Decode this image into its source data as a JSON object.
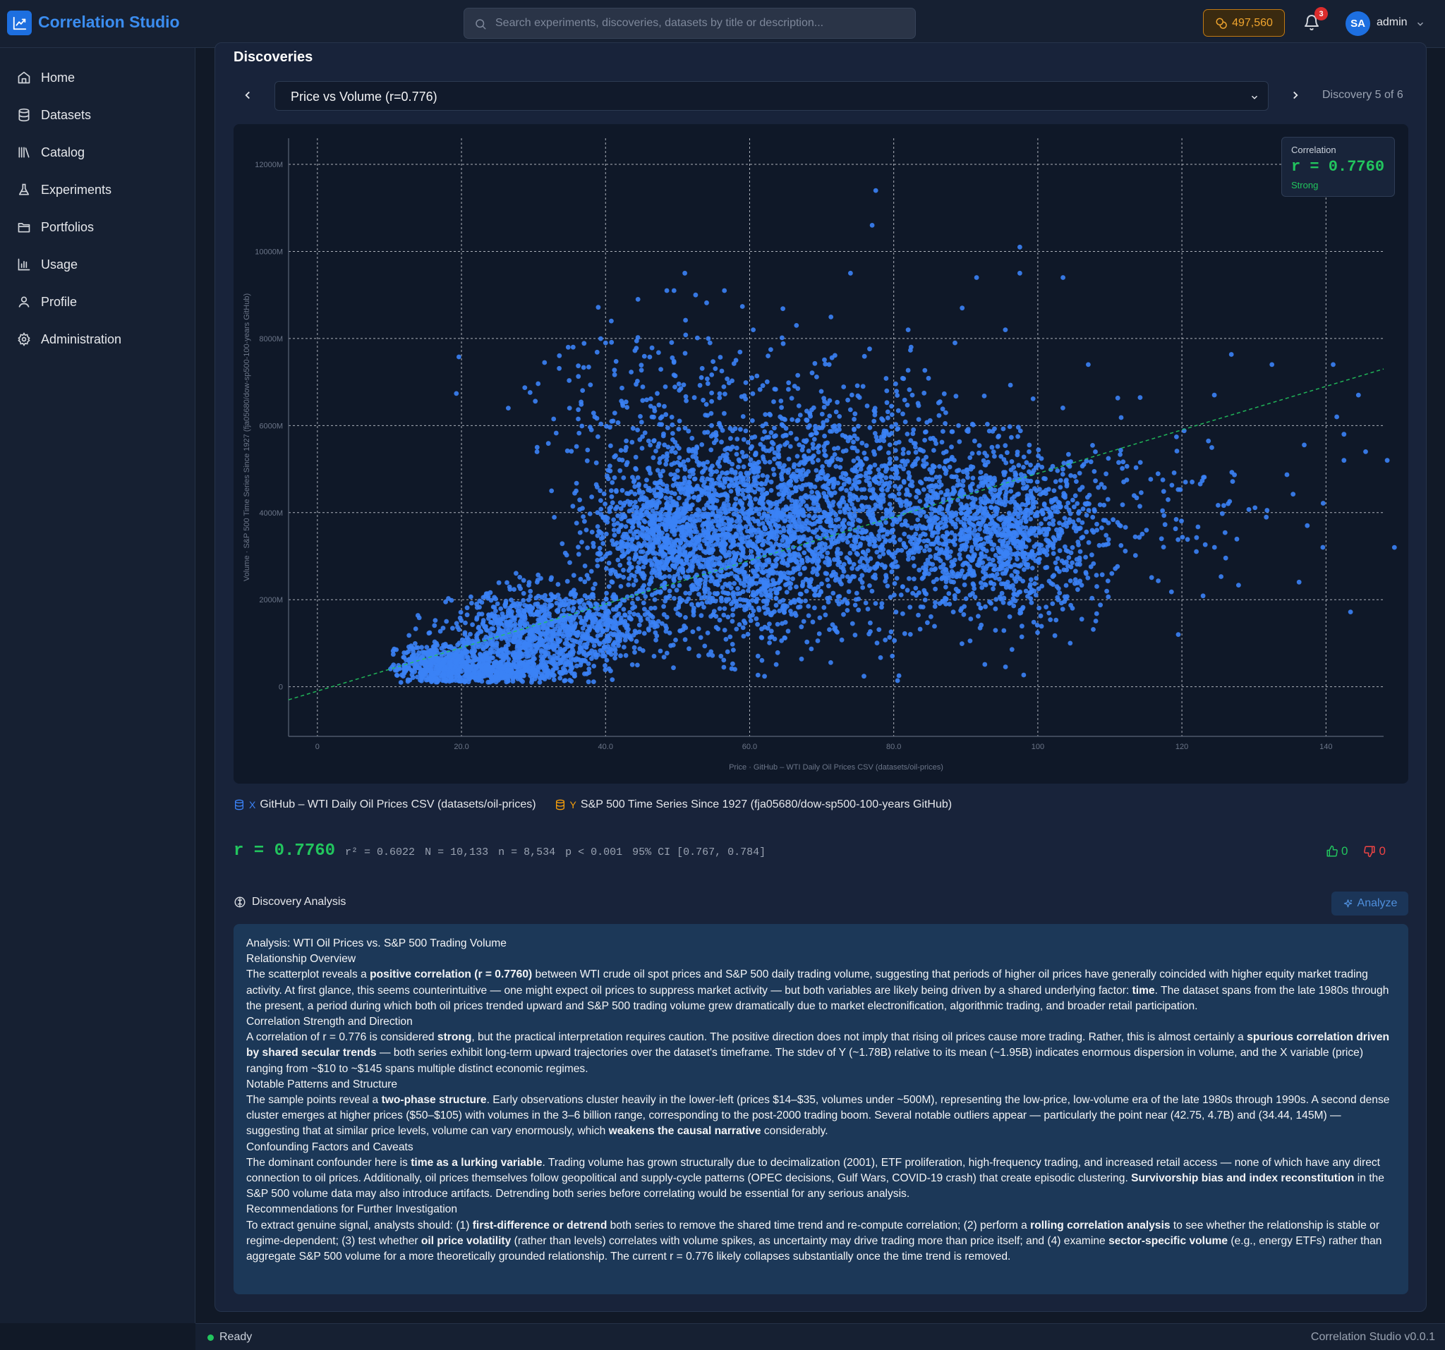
{
  "app": {
    "title": "Correlation Studio"
  },
  "header": {
    "search_placeholder": "Search experiments, discoveries, datasets by title or description...",
    "credits": "497,560",
    "notification_count": "3",
    "avatar_initials": "SA",
    "username": "admin"
  },
  "sidebar": {
    "items": [
      {
        "label": "Home",
        "icon": "home-icon"
      },
      {
        "label": "Datasets",
        "icon": "database-icon"
      },
      {
        "label": "Catalog",
        "icon": "library-icon"
      },
      {
        "label": "Experiments",
        "icon": "flask-icon"
      },
      {
        "label": "Portfolios",
        "icon": "folder-icon"
      },
      {
        "label": "Usage",
        "icon": "bar-chart-icon"
      },
      {
        "label": "Profile",
        "icon": "user-icon"
      },
      {
        "label": "Administration",
        "icon": "gear-icon"
      }
    ]
  },
  "discoveries": {
    "title": "Discoveries",
    "selected": "Price vs Volume (r=0.776)",
    "counter": "Discovery 5 of 6"
  },
  "correlation_box": {
    "label": "Correlation",
    "value": "r = 0.7760",
    "strength": "Strong"
  },
  "chart_data": {
    "type": "scatter",
    "xlabel": "Price · GitHub – WTI Daily Oil Prices CSV (datasets/oil-prices)",
    "ylabel": "Volume · S&P 500 Time Series Since 1927 (fja05680/dow-sp500-100-years GitHub)",
    "xlim": [
      -4,
      148
    ],
    "ylim": [
      -1140,
      12600
    ],
    "x_ticks": [
      {
        "value": 0,
        "label": "0"
      },
      {
        "value": 20,
        "label": "20.0"
      },
      {
        "value": 40,
        "label": "40.0"
      },
      {
        "value": 60,
        "label": "60.0"
      },
      {
        "value": 80,
        "label": "80.0"
      },
      {
        "value": 100,
        "label": "100"
      },
      {
        "value": 120,
        "label": "120"
      },
      {
        "value": 140,
        "label": "140"
      }
    ],
    "y_ticks": [
      {
        "value": 0,
        "label": "0"
      },
      {
        "value": 2000,
        "label": "2000M"
      },
      {
        "value": 4000,
        "label": "4000M"
      },
      {
        "value": 6000,
        "label": "6000M"
      },
      {
        "value": 8000,
        "label": "8000M"
      },
      {
        "value": 10000,
        "label": "10000M"
      },
      {
        "value": 12000,
        "label": "12000M"
      }
    ],
    "grid": true,
    "point_color": "#3b82f6",
    "trend_color": "#22c55e",
    "trendline": {
      "x": [
        -4,
        148
      ],
      "y": [
        -300,
        7300
      ]
    },
    "outliers": [
      [
        77.5,
        11400
      ],
      [
        77,
        10600
      ],
      [
        97.5,
        10100
      ],
      [
        51,
        9500
      ],
      [
        48.5,
        9100
      ],
      [
        49.5,
        9100
      ],
      [
        52.5,
        9000
      ],
      [
        44.5,
        8900
      ],
      [
        56.5,
        9100
      ],
      [
        74,
        9500
      ],
      [
        91.5,
        9400
      ],
      [
        97.5,
        9500
      ],
      [
        103.5,
        9400
      ],
      [
        89.5,
        8700
      ],
      [
        95.5,
        8200
      ],
      [
        66.5,
        8300
      ],
      [
        60.5,
        8200
      ],
      [
        82,
        8200
      ],
      [
        35.5,
        7800
      ],
      [
        40,
        7900
      ],
      [
        54.5,
        7900
      ],
      [
        88.5,
        7900
      ],
      [
        107,
        7400
      ],
      [
        132.5,
        7400
      ],
      [
        141,
        7400
      ],
      [
        124.5,
        6700
      ],
      [
        144.5,
        6700
      ],
      [
        141.5,
        6200
      ],
      [
        142.5,
        5800
      ],
      [
        142.5,
        5200
      ],
      [
        145.5,
        5400
      ],
      [
        148.5,
        5200
      ],
      [
        149.5,
        3200
      ],
      [
        26.5,
        6400
      ],
      [
        119.5,
        1200
      ],
      [
        104.5,
        1000
      ],
      [
        32.5,
        4500
      ],
      [
        30.5,
        5500
      ],
      [
        35,
        6400
      ],
      [
        38.5,
        6200
      ],
      [
        42.5,
        4800
      ],
      [
        34.4,
        145
      ]
    ],
    "clusters": [
      {
        "cx": 17,
        "cy": 500,
        "sx": 3.5,
        "sy": 250,
        "n": 450
      },
      {
        "cx": 25,
        "cy": 350,
        "sx": 6,
        "sy": 200,
        "n": 500
      },
      {
        "cx": 29,
        "cy": 1200,
        "sx": 5,
        "sy": 500,
        "n": 700
      },
      {
        "cx": 38,
        "cy": 1400,
        "sx": 5,
        "sy": 450,
        "n": 400
      },
      {
        "cx": 48,
        "cy": 3600,
        "sx": 5,
        "sy": 800,
        "n": 900
      },
      {
        "cx": 60,
        "cy": 3300,
        "sx": 7,
        "sy": 1200,
        "n": 1300
      },
      {
        "cx": 75,
        "cy": 4200,
        "sx": 9,
        "sy": 1300,
        "n": 1200
      },
      {
        "cx": 95,
        "cy": 3500,
        "sx": 7,
        "sy": 900,
        "n": 1100
      },
      {
        "cx": 110,
        "cy": 4000,
        "sx": 14,
        "sy": 1100,
        "n": 180
      },
      {
        "cx": 50,
        "cy": 6500,
        "sx": 10,
        "sy": 900,
        "n": 220
      }
    ]
  },
  "sources": {
    "x_letter": "X",
    "x_name": "GitHub – WTI Daily Oil Prices CSV (datasets/oil-prices)",
    "y_letter": "Y",
    "y_name": "S&P 500 Time Series Since 1927 (fja05680/dow-sp500-100-years GitHub)"
  },
  "stats": {
    "r": "r = 0.7760",
    "r2": "r² = 0.6022",
    "N": "N = 10,133",
    "n": "n = 8,534",
    "p": "p < 0.001",
    "ci": "95% CI [0.767, 0.784]"
  },
  "votes": {
    "up": "0",
    "down": "0"
  },
  "analysis": {
    "header": "Discovery Analysis",
    "button": "Analyze",
    "title": "Analysis: WTI Oil Prices vs. S&P 500 Trading Volume",
    "h1": "Relationship Overview",
    "p1": [
      {
        "t": "The scatterplot reveals a "
      },
      {
        "t": "positive correlation (r = 0.7760)",
        "b": true
      },
      {
        "t": " between WTI crude oil spot prices and S&P 500 daily trading volume, suggesting that periods of higher oil prices have generally coincided with higher equity market trading activity. At first glance, this seems counterintuitive — one might expect oil prices to suppress market activity — but both variables are likely being driven by a shared underlying factor: "
      },
      {
        "t": "time",
        "b": true
      },
      {
        "t": ". The dataset spans from the late 1980s through the present, a period during which both oil prices trended upward and S&P 500 trading volume grew dramatically due to market electronification, algorithmic trading, and broader retail participation."
      }
    ],
    "h2": "Correlation Strength and Direction",
    "p2": [
      {
        "t": "A correlation of r = 0.776 is considered "
      },
      {
        "t": "strong",
        "b": true
      },
      {
        "t": ", but the practical interpretation requires caution. The positive direction does not imply that rising oil prices cause more trading. Rather, this is almost certainly a "
      },
      {
        "t": "spurious correlation driven by shared secular trends",
        "b": true
      },
      {
        "t": " — both series exhibit long-term upward trajectories over the dataset's timeframe. The stdev of Y (~1.78B) relative to its mean (~1.95B) indicates enormous dispersion in volume, and the X variable (price) ranging from ~$10 to ~$145 spans multiple distinct economic regimes."
      }
    ],
    "h3": "Notable Patterns and Structure",
    "p3": [
      {
        "t": "The sample points reveal a "
      },
      {
        "t": "two-phase structure",
        "b": true
      },
      {
        "t": ". Early observations cluster heavily in the lower-left (prices $14–$35, volumes under ~500M), representing the low-price, low-volume era of the late 1980s through 1990s. A second dense cluster emerges at higher prices ($50–$105) with volumes in the 3–6 billion range, corresponding to the post-2000 trading boom. Several notable outliers appear — particularly the point near (42.75, 4.7B) and (34.44, 145M) — suggesting that at similar price levels, volume can vary enormously, which "
      },
      {
        "t": "weakens the causal narrative",
        "b": true
      },
      {
        "t": " considerably."
      }
    ],
    "h4": "Confounding Factors and Caveats",
    "p4": [
      {
        "t": "The dominant confounder here is "
      },
      {
        "t": "time as a lurking variable",
        "b": true
      },
      {
        "t": ". Trading volume has grown structurally due to decimalization (2001), ETF proliferation, high-frequency trading, and increased retail access — none of which have any direct connection to oil prices. Additionally, oil prices themselves follow geopolitical and supply-cycle patterns (OPEC decisions, Gulf Wars, COVID-19 crash) that create episodic clustering. "
      },
      {
        "t": "Survivorship bias and index reconstitution",
        "b": true
      },
      {
        "t": " in the S&P 500 volume data may also introduce artifacts. Detrending both series before correlating would be essential for any serious analysis."
      }
    ],
    "h5": "Recommendations for Further Investigation",
    "p5": [
      {
        "t": "To extract genuine signal, analysts should: (1) "
      },
      {
        "t": "first-difference or detrend",
        "b": true
      },
      {
        "t": " both series to remove the shared time trend and re-compute correlation; (2) perform a "
      },
      {
        "t": "rolling correlation analysis",
        "b": true
      },
      {
        "t": " to see whether the relationship is stable or regime-dependent; (3) test whether "
      },
      {
        "t": "oil price volatility",
        "b": true
      },
      {
        "t": " (rather than levels) correlates with volume spikes, as uncertainty may drive trading more than price itself; and (4) examine "
      },
      {
        "t": "sector-specific volume",
        "b": true
      },
      {
        "t": " (e.g., energy ETFs) rather than aggregate S&P 500 volume for a more theoretically grounded relationship. The current r = 0.776 likely collapses substantially once the time trend is removed."
      }
    ]
  },
  "status": {
    "text": "Ready",
    "version": "Correlation Studio v0.0.1"
  }
}
